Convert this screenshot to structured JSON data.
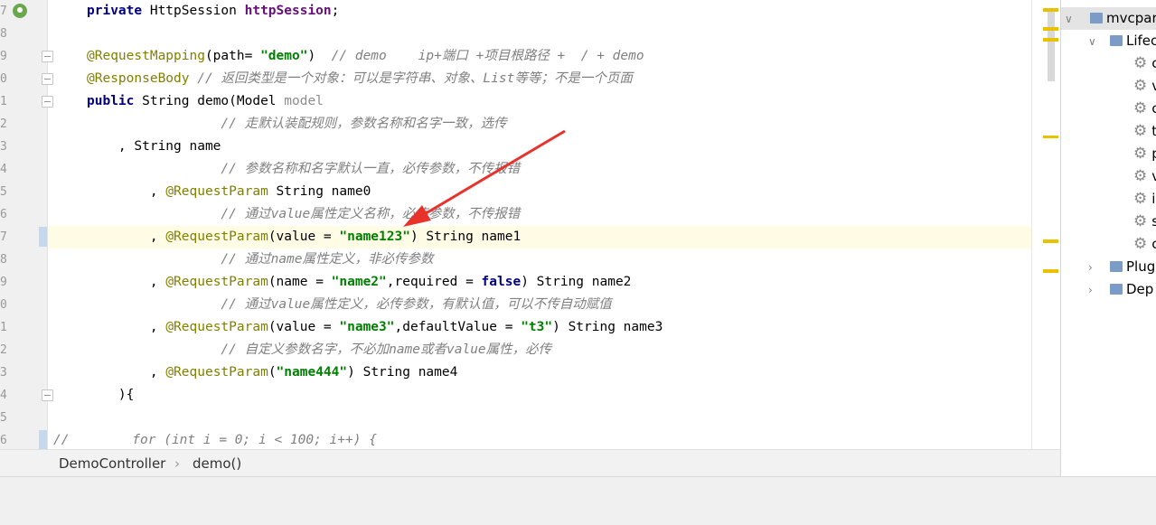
{
  "gutter": {
    "line_numbers": [
      "7",
      "8",
      "9",
      "0",
      "1",
      "2",
      "3",
      "4",
      "5",
      "6",
      "7",
      "8",
      "9",
      "0",
      "1",
      "2",
      "3",
      "4",
      "5",
      "6"
    ]
  },
  "code": {
    "l1": {
      "kw": "private",
      "a": " HttpSession ",
      "fld": "httpSession",
      "b": ";"
    },
    "l3": {
      "an": "@RequestMapping",
      "a": "(path= ",
      "str": "\"demo\"",
      "b": ")  ",
      "cm": "// demo    ip+端口 +项目根路径 +  / + demo"
    },
    "l4": {
      "an": "@ResponseBody",
      "a": " ",
      "cm": "// 返回类型是一个对象：可以是字符串、对象、List等等；不是一个页面"
    },
    "l5": {
      "kw": "public",
      "a": " String demo(Model ",
      "par": "model"
    },
    "l6": {
      "a": "                 ",
      "cm": "// 走默认装配规则，参数名称和名字一致，选传"
    },
    "l7": {
      "a": "    , String name"
    },
    "l8": {
      "a": "                 ",
      "cm": "// 参数名称和名字默认一直，必传参数，不传报错"
    },
    "l9": {
      "a": "        , ",
      "an": "@RequestParam",
      "b": " String name0"
    },
    "l10": {
      "a": "                 ",
      "cm": "// 通过value属性定义名称，必传参数，不传报错"
    },
    "l11": {
      "a": "        , ",
      "an": "@RequestParam",
      "b": "(value = ",
      "str": "\"name123\"",
      "c": ") String name1"
    },
    "l12": {
      "a": "                 ",
      "cm": "// 通过name属性定义，非必传参数"
    },
    "l13": {
      "a": "        , ",
      "an": "@RequestParam",
      "b": "(name = ",
      "str": "\"name2\"",
      "c": ",required = ",
      "kw": "false",
      "d": ") String name2"
    },
    "l14": {
      "a": "                 ",
      "cm": "// 通过value属性定义，必传参数，有默认值，可以不传自动赋值"
    },
    "l15": {
      "a": "        , ",
      "an": "@RequestParam",
      "b": "(value = ",
      "str": "\"name3\"",
      "c": ",defaultValue = ",
      "str2": "\"t3\"",
      "d": ") String name3"
    },
    "l16": {
      "a": "                 ",
      "cm": "// 自定义参数名字，不必加name或者value属性，必传"
    },
    "l17": {
      "a": "        , ",
      "an": "@RequestParam",
      "b": "(",
      "str": "\"name444\"",
      "c": ") String name4"
    },
    "l18": {
      "a": "    ){"
    },
    "l20": {
      "cm1": "//",
      "cm2": "        for (int i = 0; i < 100; i++) {"
    }
  },
  "breadcrumb": {
    "class_name": "DemoController",
    "separator": "›",
    "method": "demo()"
  },
  "sidebar": {
    "root": "mvcpara",
    "lifecycle": "Lifec",
    "goals": [
      "c",
      "v",
      "c",
      "t",
      "p",
      "v",
      "i",
      "s",
      "c"
    ],
    "plugins": "Plug",
    "dependencies": "Dep"
  },
  "colors": {
    "keyword": "#000080",
    "annotation": "#808000",
    "string": "#008000",
    "comment": "#808080",
    "arrow": "#e8322c",
    "caret_line": "#fffce6"
  }
}
